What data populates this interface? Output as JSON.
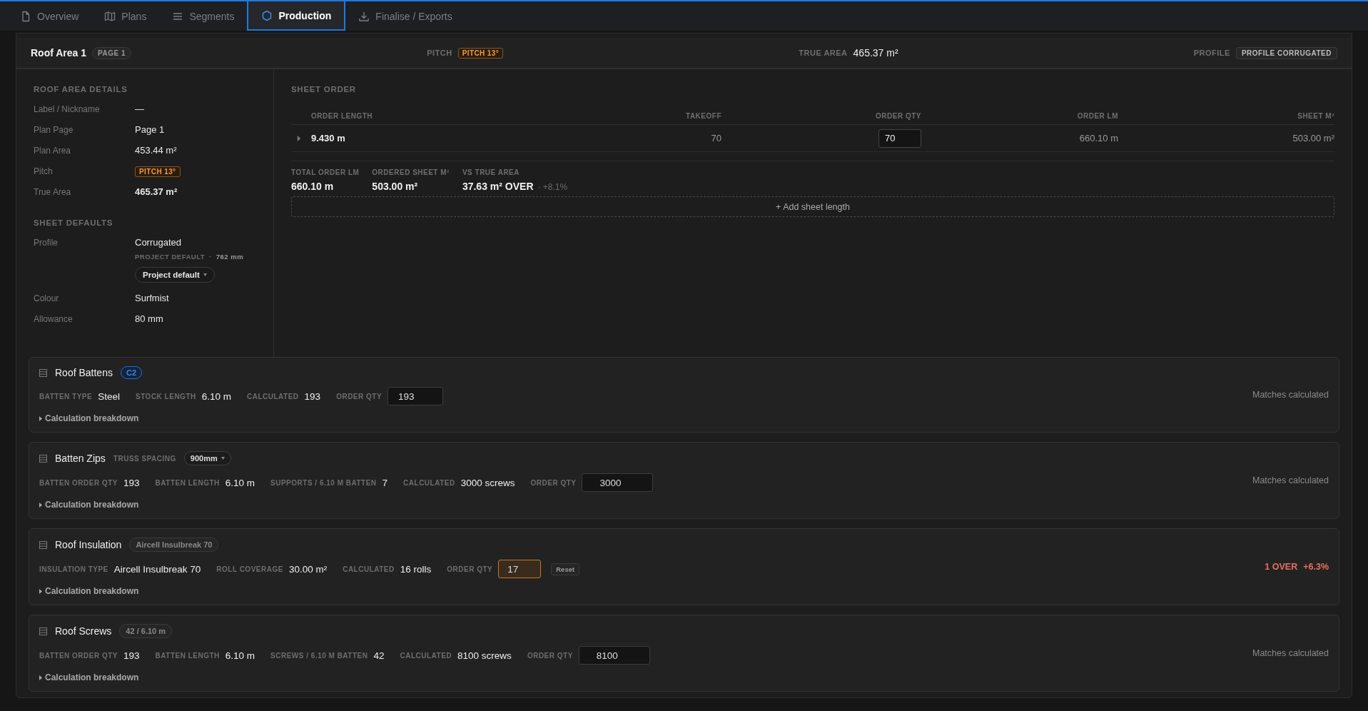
{
  "tabs": [
    {
      "label": "Overview",
      "selected": false
    },
    {
      "label": "Plans",
      "selected": false
    },
    {
      "label": "Segments",
      "selected": false
    },
    {
      "label": "Production",
      "selected": true
    },
    {
      "label": "Finalise / Exports",
      "selected": false
    }
  ],
  "header": {
    "title": "Roof Area 1",
    "page_badge": "PAGE 1",
    "pitch_label": "PITCH",
    "pitch_badge": "PITCH 13°",
    "true_area_label": "TRUE AREA",
    "true_area_value": "465.37 m²",
    "profile_label": "PROFILE",
    "profile_badge": "PROFILE CORRUGATED"
  },
  "roof_area_details": {
    "heading": "ROOF AREA DETAILS",
    "rows": [
      {
        "label": "Label / Nickname",
        "value": "—",
        "kind": "text"
      },
      {
        "label": "Plan Page",
        "value": "Page 1",
        "kind": "text"
      },
      {
        "label": "Plan Area",
        "value": "453.44 m²",
        "kind": "text"
      },
      {
        "label": "Pitch",
        "value": "PITCH 13°",
        "kind": "badge"
      },
      {
        "label": "True Area",
        "value": "465.37 m²",
        "kind": "bold"
      }
    ]
  },
  "sheet_defaults": {
    "heading": "SHEET DEFAULTS",
    "profile": {
      "label": "Profile",
      "value": "Corrugated",
      "source": "PROJECT DEFAULT",
      "separator": "·",
      "cover": "762 mm",
      "button": "Project default"
    },
    "rows": [
      {
        "label": "Colour",
        "value": "Surfmist"
      },
      {
        "label": "Allowance",
        "value": "80 mm"
      }
    ]
  },
  "sheet_order": {
    "heading": "SHEET ORDER",
    "columns": [
      "ORDER LENGTH",
      "TAKEOFF",
      "ORDER QTY",
      "ORDER LM",
      "SHEET M²"
    ],
    "rows": [
      {
        "expanded": false,
        "order_length": "9.430 m",
        "takeoff": "70",
        "order_qty": "70",
        "order_lm": "660.10 m",
        "sheet_m2": "503.00 m²"
      }
    ],
    "totals": [
      {
        "label": "TOTAL ORDER LM",
        "value": "660.10 m"
      },
      {
        "label": "ORDERED SHEET M²",
        "value": "503.00 m²"
      },
      {
        "label": "VS TRUE AREA",
        "value": "37.63 m² OVER",
        "note": "· +8.1%"
      }
    ],
    "add_button": "+ Add sheet length"
  },
  "cards": [
    {
      "title": "Roof Battens",
      "tag": {
        "kind": "accent",
        "text": "C2"
      },
      "fields": [
        {
          "label": "BATTEN TYPE",
          "value": "Steel"
        },
        {
          "label": "STOCK LENGTH",
          "value": "6.10 m"
        },
        {
          "label": "CALCULATED",
          "value": "193"
        }
      ],
      "order_qty_label": "ORDER QTY",
      "order_qty": "193",
      "modified": false,
      "over": false,
      "status": [
        "Matches calculated"
      ],
      "breakdown": "Calculation breakdown"
    },
    {
      "title": "Batten Zips",
      "tag": {
        "kind": "select",
        "label": "TRUSS SPACING",
        "text": "900mm"
      },
      "fields": [
        {
          "label": "BATTEN ORDER QTY",
          "value": "193"
        },
        {
          "label": "BATTEN LENGTH",
          "value": "6.10 m"
        },
        {
          "label": "SUPPORTS / 6.10 M BATTEN",
          "value": "7"
        },
        {
          "label": "CALCULATED",
          "value": "3000 screws"
        }
      ],
      "order_qty_label": "ORDER QTY",
      "order_qty": "3000",
      "modified": false,
      "over": false,
      "status": [
        "Matches calculated"
      ],
      "breakdown": "Calculation breakdown"
    },
    {
      "title": "Roof Insulation",
      "tag": {
        "kind": "pill",
        "text": "Aircell Insulbreak 70"
      },
      "fields": [
        {
          "label": "INSULATION TYPE",
          "value": "Aircell Insulbreak 70"
        },
        {
          "label": "ROLL COVERAGE",
          "value": "30.00 m²"
        },
        {
          "label": "CALCULATED",
          "value": "16 rolls"
        }
      ],
      "order_qty_label": "ORDER QTY",
      "order_qty": "17",
      "modified": true,
      "reset": "Reset",
      "over": true,
      "status": [
        "1 OVER",
        "+6.3%"
      ],
      "breakdown": "Calculation breakdown"
    },
    {
      "title": "Roof Screws",
      "tag": {
        "kind": "pill",
        "text": "42 / 6.10 m"
      },
      "fields": [
        {
          "label": "BATTEN ORDER QTY",
          "value": "193"
        },
        {
          "label": "BATTEN LENGTH",
          "value": "6.10 m"
        },
        {
          "label": "SCREWS / 6.10 M BATTEN",
          "value": "42"
        },
        {
          "label": "CALCULATED",
          "value": "8100 screws"
        }
      ],
      "order_qty_label": "ORDER QTY",
      "order_qty": "8100",
      "modified": false,
      "over": false,
      "status": [
        "Matches calculated"
      ],
      "breakdown": "Calculation breakdown"
    }
  ]
}
